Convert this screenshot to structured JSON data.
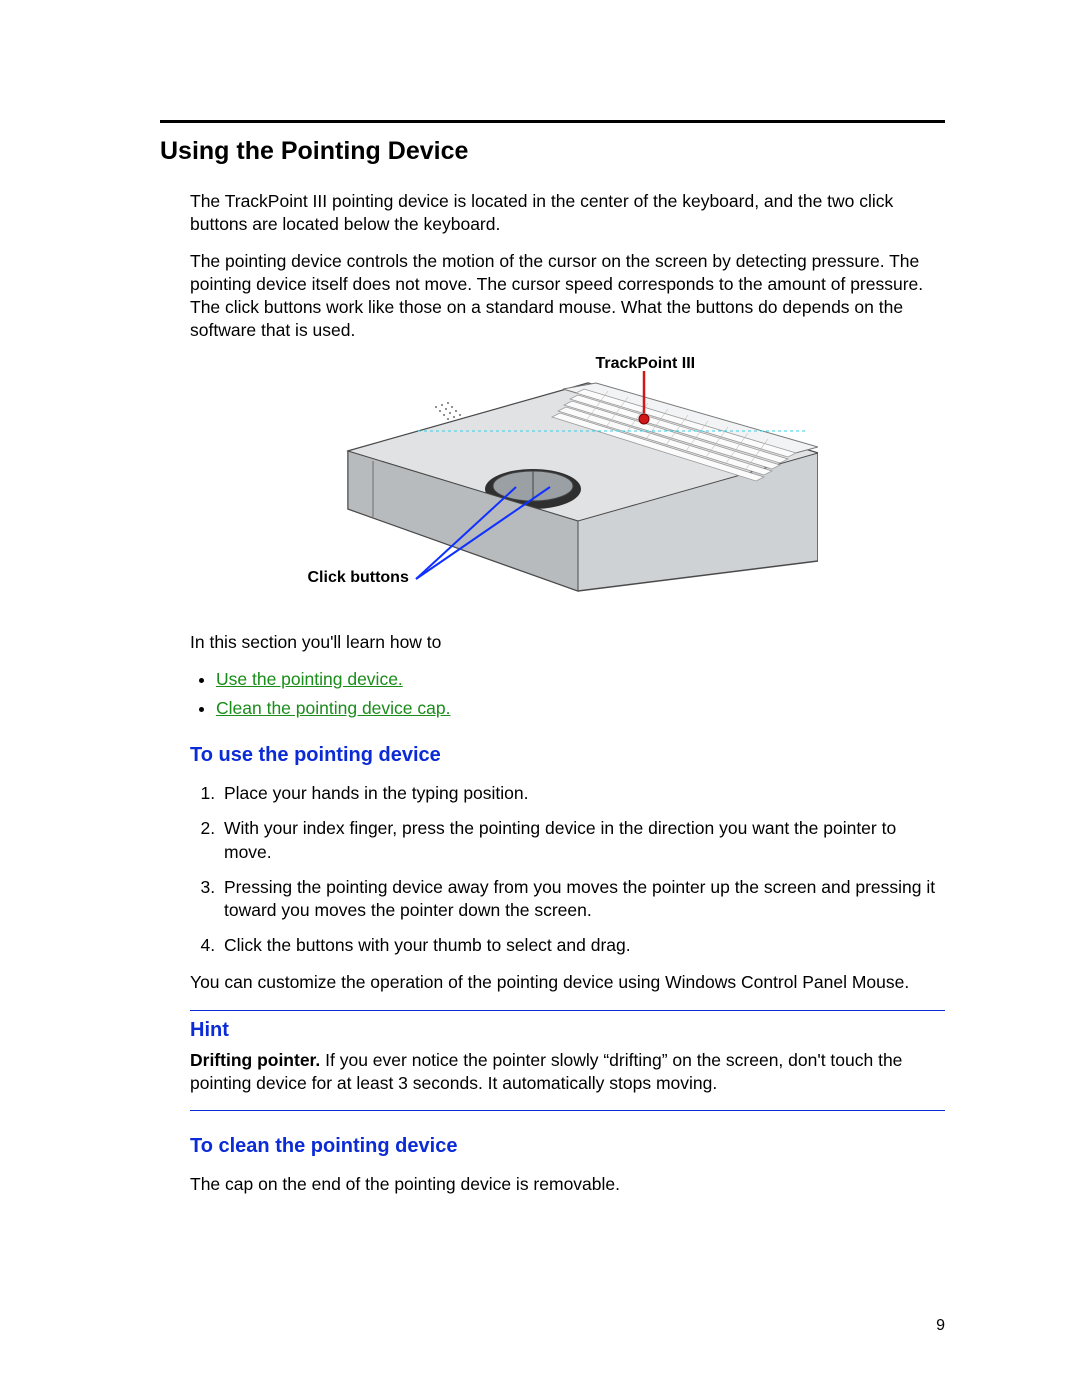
{
  "title": "Using the Pointing Device",
  "intro1": "The TrackPoint III pointing device is located in the center of the keyboard, and the two click buttons are located below the keyboard.",
  "intro2": "The pointing device controls the motion of the cursor on the screen by detecting pressure. The pointing device itself does not move. The cursor speed corresponds to the amount of pressure. The click buttons work like those on a standard mouse. What the buttons do depends on the software that is used.",
  "figure": {
    "label_top": "TrackPoint III",
    "label_bottom": "Click buttons"
  },
  "learn_lead": "In this section you'll learn how to",
  "links": [
    "Use the pointing device.",
    "Clean the pointing device cap."
  ],
  "sub1": {
    "heading": "To use the pointing device",
    "steps": [
      "Place your hands in the typing position.",
      "With your index finger, press the pointing device in the direction you want the pointer to move.",
      "Pressing the pointing device away from you moves the pointer up the screen and pressing it toward you moves the pointer down the screen.",
      "Click the buttons with your thumb to select and drag."
    ],
    "after": "You can customize the operation of the pointing device using Windows Control Panel Mouse."
  },
  "hint": {
    "title": "Hint",
    "lead": "Drifting pointer.",
    "body": " If you ever notice the pointer slowly “drifting” on the screen, don't touch the pointing device for at least 3 seconds. It automatically stops moving."
  },
  "sub2": {
    "heading": "To clean the pointing device",
    "text": "The cap on the end of the pointing device is removable."
  },
  "page_number": "9"
}
